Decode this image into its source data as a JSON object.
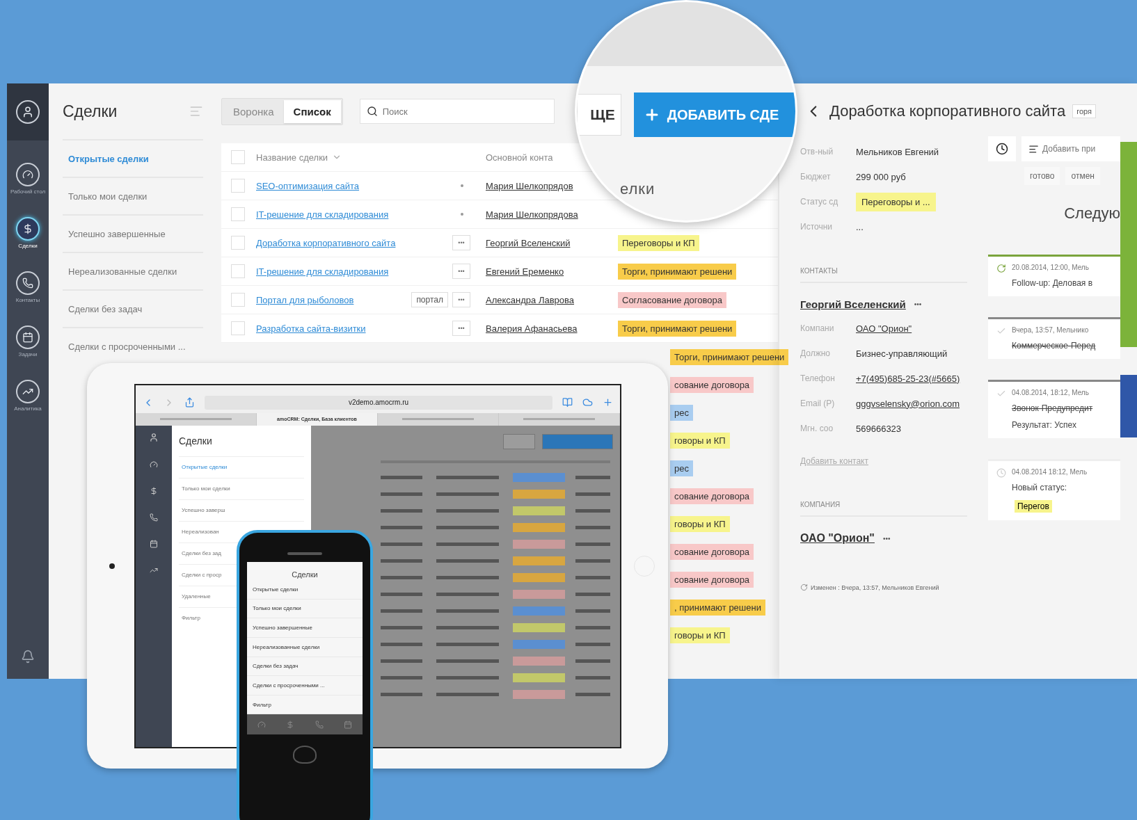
{
  "nav": {
    "items": [
      {
        "label": "Рабочий стол",
        "kind": "dashboard",
        "selected": false
      },
      {
        "label": "Сделки",
        "kind": "deals",
        "selected": true
      },
      {
        "label": "Контакты",
        "kind": "contacts",
        "selected": false
      },
      {
        "label": "Задачи",
        "kind": "tasks",
        "selected": false
      },
      {
        "label": "Аналитика",
        "kind": "analytics",
        "selected": false
      }
    ]
  },
  "filters": {
    "title": "Сделки",
    "items": [
      {
        "label": "Открытые сделки",
        "selected": true
      },
      {
        "label": "Только мои сделки",
        "selected": false
      },
      {
        "label": "Успешно завершенные",
        "selected": false
      },
      {
        "label": "Нереализованные сделки",
        "selected": false
      },
      {
        "label": "Сделки без задач",
        "selected": false
      },
      {
        "label": "Сделки с просроченными ...",
        "selected": false
      }
    ]
  },
  "view_tabs": [
    {
      "label": "Воронка",
      "selected": false
    },
    {
      "label": "Список",
      "selected": true
    }
  ],
  "search": {
    "placeholder": "Поиск"
  },
  "table": {
    "columns": [
      "Название сделки",
      "Основной конта"
    ],
    "header_checked": false,
    "rows": [
      {
        "checked": false,
        "name": "SEO-оптимизация сайта",
        "contact": "Мария Шелкопрядов"
      },
      {
        "checked": false,
        "name": "IT-решение для складирования",
        "contact": "Мария Шелкопрядова"
      },
      {
        "checked": false,
        "name": "Доработка корпоративного сайта",
        "more": "•••",
        "contact": "Георгий Вселенский",
        "status": {
          "text": "Переговоры и КП",
          "color": "#f7f48c"
        }
      },
      {
        "checked": false,
        "name": "IT-решение для складирования",
        "more": "•••",
        "contact": "Евгений Еременко",
        "status": {
          "text": "Торги, принимают решени",
          "color": "#f8cc4a"
        }
      },
      {
        "checked": false,
        "name": "Портал для рыболовов",
        "tag": "портал",
        "more": "•••",
        "contact": "Александра Лаврова",
        "status": {
          "text": "Согласование договора",
          "color": "#f8c8c8"
        }
      },
      {
        "checked": false,
        "name": "Разработка сайта-визитки",
        "more": "•••",
        "contact": "Валерия Афанасьева",
        "status": {
          "text": "Торги, принимают решени",
          "color": "#f8cc4a"
        }
      }
    ],
    "partial_statuses": [
      {
        "text": "Торги, принимают решени",
        "color": "#f8cc4a"
      },
      {
        "text": "сование договора",
        "color": "#f8c8c8"
      },
      {
        "text": "рес",
        "color": "#a9cdf0"
      },
      {
        "text": "говоры и КП",
        "color": "#f7f48c"
      },
      {
        "text": "рес",
        "color": "#a9cdf0"
      },
      {
        "text": "сование договора",
        "color": "#f8c8c8"
      },
      {
        "text": "говоры и КП",
        "color": "#f7f48c"
      },
      {
        "text": "сование договора",
        "color": "#f8c8c8"
      },
      {
        "text": "сование договора",
        "color": "#f8c8c8"
      },
      {
        "text": ", принимают решени",
        "color": "#f8cc4a"
      },
      {
        "text": "говоры и КП",
        "color": "#f7f48c"
      }
    ]
  },
  "magnifier": {
    "more_button": "ЩЕ",
    "add_button": "ДОБАВИТЬ СДЕ",
    "caption": "елки"
  },
  "detail": {
    "title": "Доработка корпоративного сайта",
    "tag": "горя",
    "fields": [
      {
        "label": "Отв-ный",
        "value": "Мельников Евгений",
        "kind": "text"
      },
      {
        "label": "Бюджет",
        "value": "299 000 руб",
        "kind": "text"
      },
      {
        "label": "Статус сд",
        "value": "Переговоры и ...",
        "kind": "status"
      },
      {
        "label": "Источни",
        "value": "...",
        "kind": "text"
      }
    ],
    "contacts_heading": "КОНТАКТЫ",
    "contact": {
      "name": "Георгий Вселенский",
      "more": "•••",
      "fields": [
        {
          "label": "Компани",
          "value": "ОАО \"Орион\"",
          "kind": "link"
        },
        {
          "label": "Должно",
          "value": "Бизнес-управляющий",
          "kind": "text"
        },
        {
          "label": "Телефон",
          "value": "+7(495)685-25-23(#5665)",
          "kind": "link"
        },
        {
          "label": "Email (Р)",
          "value": "gggvselensky@orion.com",
          "kind": "link"
        },
        {
          "label": "Мгн. соо",
          "value": "569666323",
          "kind": "text"
        }
      ]
    },
    "add_contact": "Добавить контакт",
    "company_heading": "КОМПАНИЯ",
    "company": "ОАО \"Орион\"",
    "company_more": "•••",
    "modified": "Изменен : Вчера, 13:57, Мельников Евгений",
    "note_placeholder": "Добавить при",
    "note_buttons": [
      "готово",
      "отмен"
    ],
    "next_heading": "Следую",
    "events": [
      {
        "kind": "task",
        "meta": "20.08.2014, 12:00, Мель",
        "lines": [
          {
            "text": "Follow-up: Деловая в",
            "struck": false
          }
        ]
      },
      {
        "kind": "done",
        "meta": "Вчера, 13:57, Мельнико",
        "lines": [
          {
            "text": "Коммерческое-Перед",
            "struck": true
          }
        ]
      },
      {
        "kind": "done",
        "meta": "04.08.2014, 18:12, Мель",
        "lines": [
          {
            "text": "Звонок-Предупредит",
            "struck": true
          },
          {
            "text": "Результат: Успех",
            "struck": false
          }
        ]
      },
      {
        "kind": "status",
        "meta": "04.08.2014 18:12, Мель",
        "lines": [
          {
            "text": "Новый статус:",
            "struck": false
          }
        ],
        "status": "Перегов"
      }
    ]
  },
  "tablet": {
    "url": "v2demo.amocrm.ru",
    "tabs": [
      {
        "selected": false
      },
      {
        "label": "amoCRM: Сделки, База клиентов",
        "selected": true
      },
      {
        "selected": false
      },
      {
        "selected": false
      }
    ],
    "title": "Сделки",
    "filters": [
      {
        "label": "Открытые сделки",
        "selected": true
      },
      {
        "label": "Только мои сделки",
        "selected": false
      },
      {
        "label": "Успешно заверш",
        "selected": false
      },
      {
        "label": "Нереализован",
        "selected": false
      },
      {
        "label": "Сделки без зад",
        "selected": false
      },
      {
        "label": "Сделки с проср",
        "selected": false
      },
      {
        "label": "Удаленные",
        "selected": false
      },
      {
        "label": "Фильтр",
        "selected": false
      }
    ],
    "table_rows": [
      {
        "color": "#5b8fd0"
      },
      {
        "color": "#d8a640"
      },
      {
        "color": "#c2c86a"
      },
      {
        "color": "#d8a640"
      },
      {
        "color": "#c99a9a"
      },
      {
        "color": "#d8a640"
      },
      {
        "color": "#d8a640"
      },
      {
        "color": "#c99a9a"
      },
      {
        "color": "#5b8fd0"
      },
      {
        "color": "#c2c86a"
      },
      {
        "color": "#5b8fd0"
      },
      {
        "color": "#c99a9a"
      },
      {
        "color": "#c2c86a"
      },
      {
        "color": "#c99a9a"
      }
    ]
  },
  "phone": {
    "title": "Сделки",
    "items": [
      "Открытые сделки",
      "Только мои сделки",
      "Успешно завершенные",
      "Нереализованные сделки",
      "Сделки без задач",
      "Сделки с просроченными ...",
      "Фильтр"
    ]
  }
}
